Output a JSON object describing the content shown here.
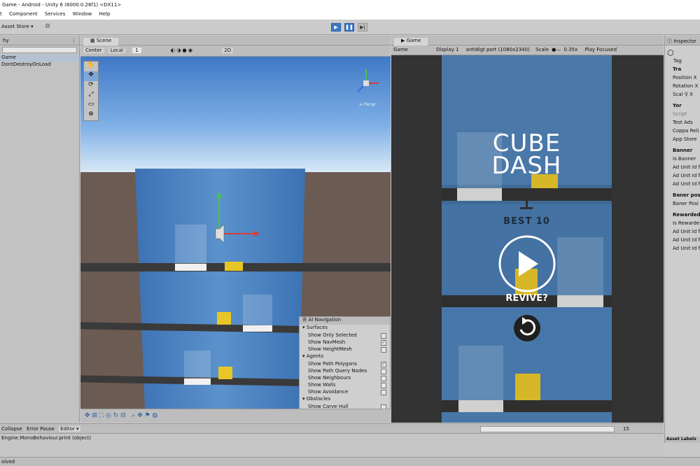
{
  "window": {
    "title": "Game - Android - Unity 6 (6000.0.26f1) <DX11>",
    "menus": [
      "t",
      "Component",
      "Services",
      "Window",
      "Help"
    ]
  },
  "toolbar": {
    "asset_store": "Asset Store ▾",
    "play": "▶",
    "pause": "❚❚",
    "step": "▶|"
  },
  "hierarchy": {
    "tab": "hy",
    "items": [
      "Game",
      "DontDestroyOnLoad"
    ]
  },
  "scene": {
    "tab": "Scene",
    "pivot": "Center",
    "space": "Local",
    "grid_value": "1",
    "mode_2d": "2D",
    "persp_label": "≡ Persp"
  },
  "ai_navigation": {
    "title": "AI Navigation",
    "sections": [
      {
        "name": "Surfaces",
        "items": [
          {
            "label": "Show Only Selected",
            "checked": false
          },
          {
            "label": "Show NavMesh",
            "checked": true
          },
          {
            "label": "Show HeightMesh",
            "checked": false
          }
        ]
      },
      {
        "name": "Agents",
        "items": [
          {
            "label": "Show Path Polygons",
            "checked": true
          },
          {
            "label": "Show Path Query Nodes",
            "checked": false
          },
          {
            "label": "Show Neighbours",
            "checked": false
          },
          {
            "label": "Show Walls",
            "checked": false
          },
          {
            "label": "Show Avoidance",
            "checked": false
          }
        ]
      },
      {
        "name": "Obstacles",
        "items": [
          {
            "label": "Show Carve Hull",
            "checked": false
          }
        ]
      }
    ]
  },
  "game": {
    "tab": "Game",
    "mode": "Game",
    "display": "Display 1",
    "resolution": "antidigt port (1080x2340)",
    "scale_label": "Scale",
    "scale_value": "0.35x",
    "play_mode": "Play Focused",
    "title_line1": "CUBE",
    "title_line2": "DASH",
    "best": "BEST 10",
    "revive": "REVIVE?"
  },
  "inspector": {
    "tab": "Inspector",
    "tag": "Tag",
    "rows": [
      "Tra",
      "Position X",
      "Rotation X",
      "Scal ⚲ X",
      "Yor",
      "Script",
      "Test Ads",
      "Coppa Reli",
      "App Store",
      "Banner",
      "Is Banner",
      "Ad Unit Id f",
      "Ad Unit Id f",
      "Ad Unit Id f",
      "Baner posi",
      "Baner Posi",
      "Rewarded",
      "Is Rewarde",
      "Ad Unit Id f",
      "Ad Unit Id f",
      "Ad Unit Id f"
    ],
    "asset_labels": "Asset Labels"
  },
  "console": {
    "buttons": [
      "Collapse",
      "Error Pause",
      "Editor ▾"
    ],
    "message": "Engine.MonoBehaviour.print (object)",
    "count": "15"
  },
  "status": "olved",
  "colors": {
    "accent": "#3a78c8",
    "sky": "#6fa0d6",
    "ground": "#6b5b52",
    "game_bg": "#3f6a95",
    "yellow": "#e8c626"
  }
}
